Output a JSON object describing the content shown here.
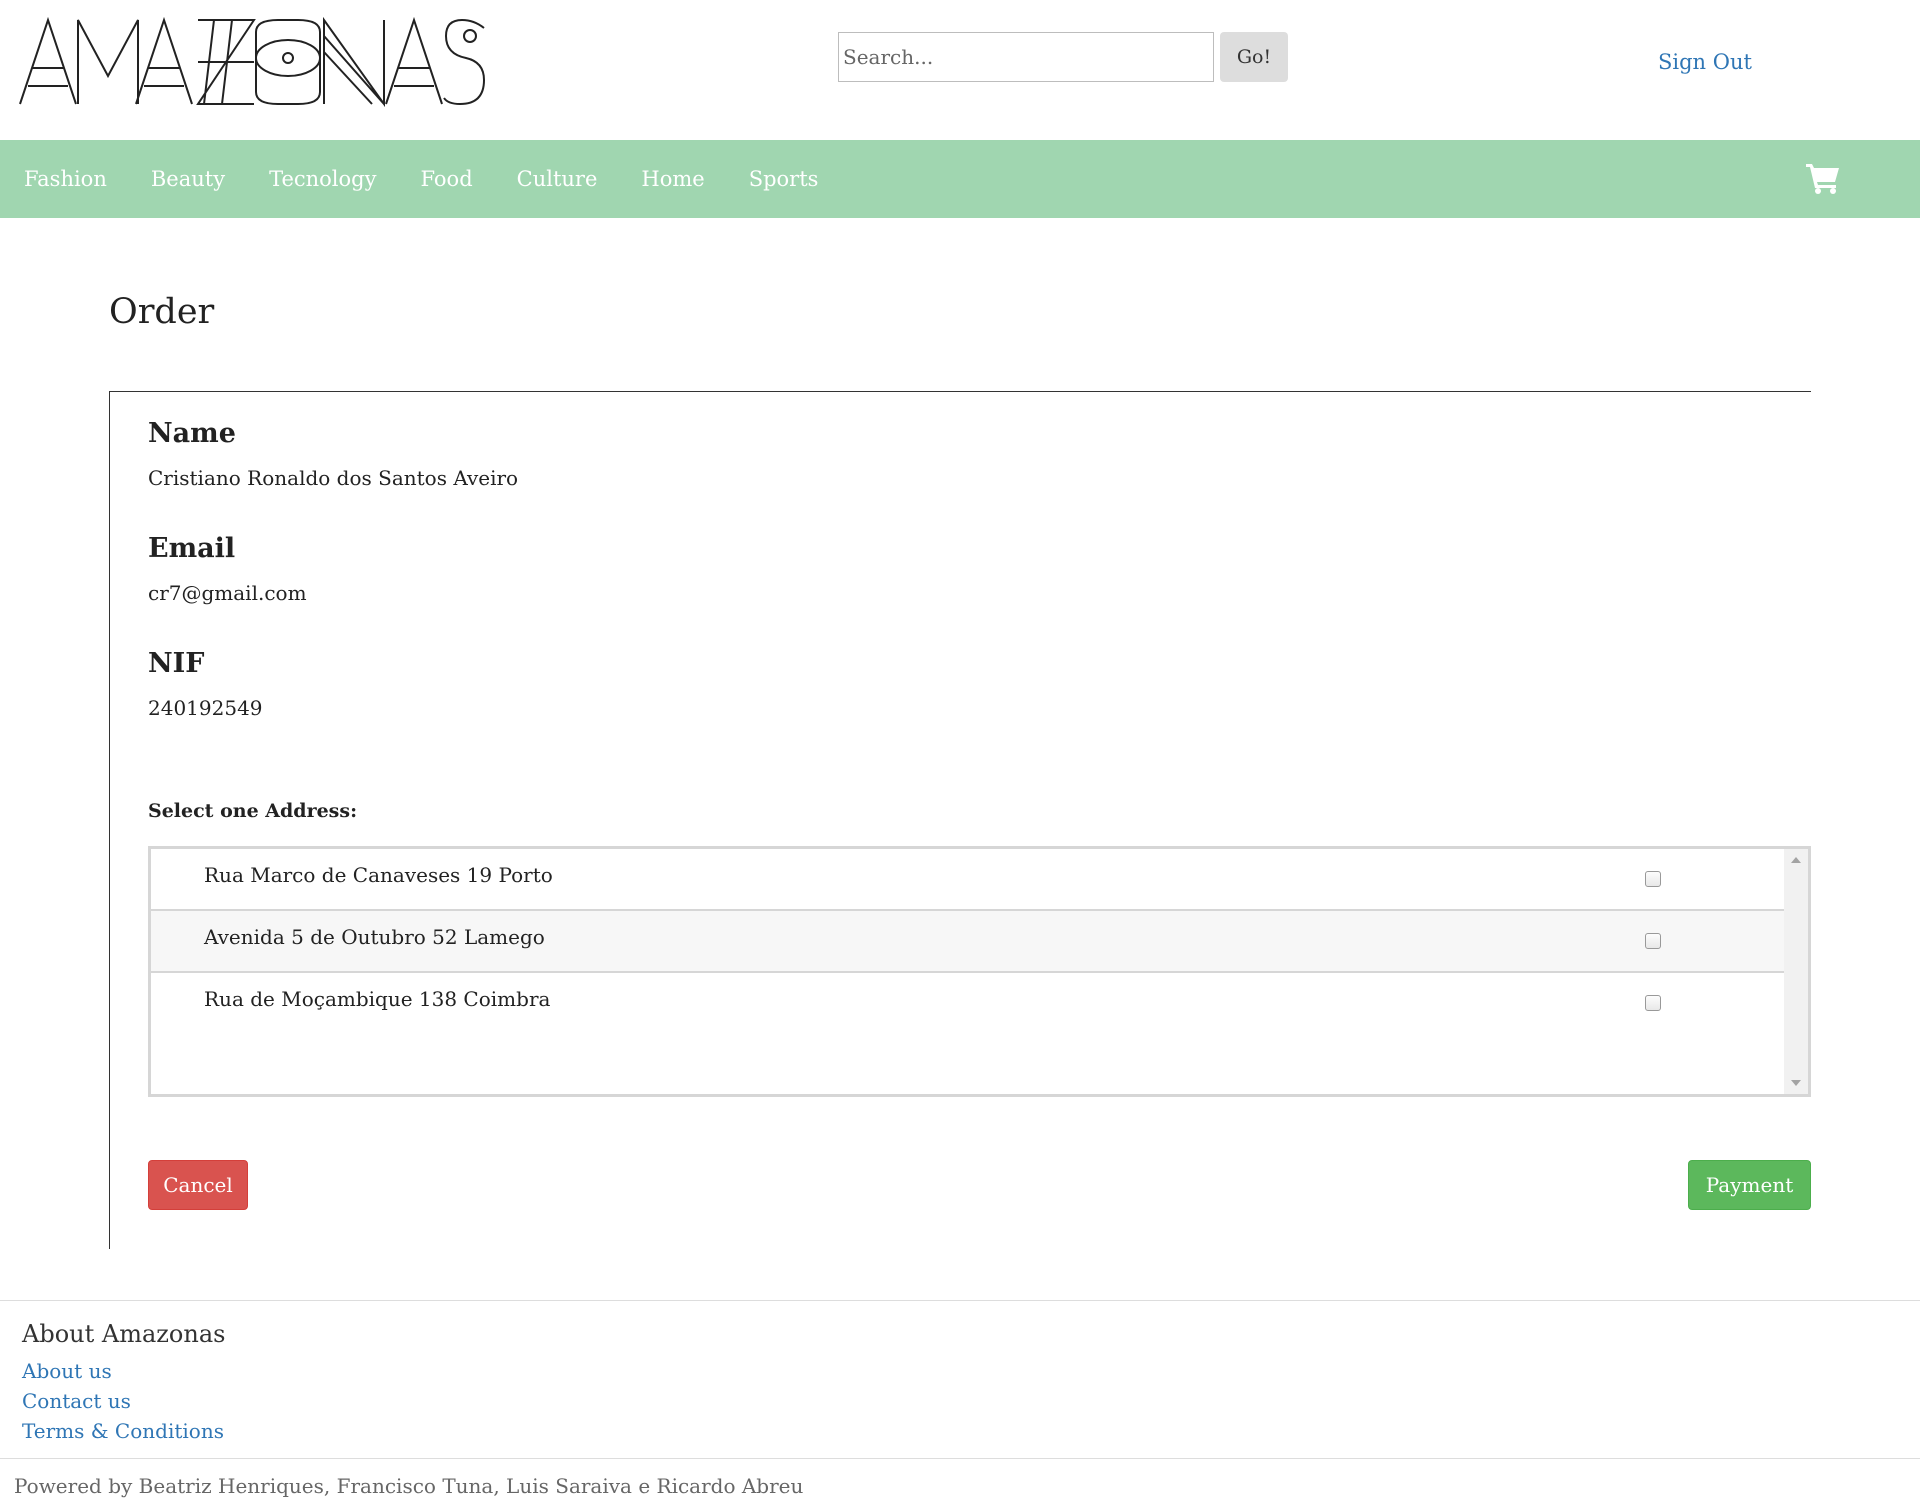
{
  "brand": {
    "logo_text": "AMAZONAS"
  },
  "header": {
    "search_placeholder": "Search...",
    "go_label": "Go!",
    "sign_out_label": "Sign Out"
  },
  "nav": {
    "items": [
      "Fashion",
      "Beauty",
      "Tecnology",
      "Food",
      "Culture",
      "Home",
      "Sports"
    ],
    "cart_icon": "shopping-cart-icon",
    "background_color": "#a0d6b0"
  },
  "main": {
    "title": "Order",
    "name_label": "Name",
    "name_value": "Cristiano Ronaldo dos Santos Aveiro",
    "email_label": "Email",
    "email_value": "cr7@gmail.com",
    "nif_label": "NIF",
    "nif_value": "240192549",
    "address_label": "Select one Address:",
    "addresses": [
      {
        "text": "Rua Marco de Canaveses 19 Porto",
        "checked": false
      },
      {
        "text": "Avenida 5 de Outubro 52 Lamego",
        "checked": false
      },
      {
        "text": "Rua de Moçambique 138 Coimbra",
        "checked": false
      }
    ],
    "cancel_label": "Cancel",
    "payment_label": "Payment",
    "cancel_color": "#d9534f",
    "payment_color": "#5cb85c"
  },
  "footer": {
    "title": "About Amazonas",
    "links": [
      "About us",
      "Contact us",
      "Terms & Conditions"
    ],
    "powered_by": "Powered by Beatriz Henriques, Francisco Tuna, Luis Saraiva e Ricardo Abreu"
  }
}
